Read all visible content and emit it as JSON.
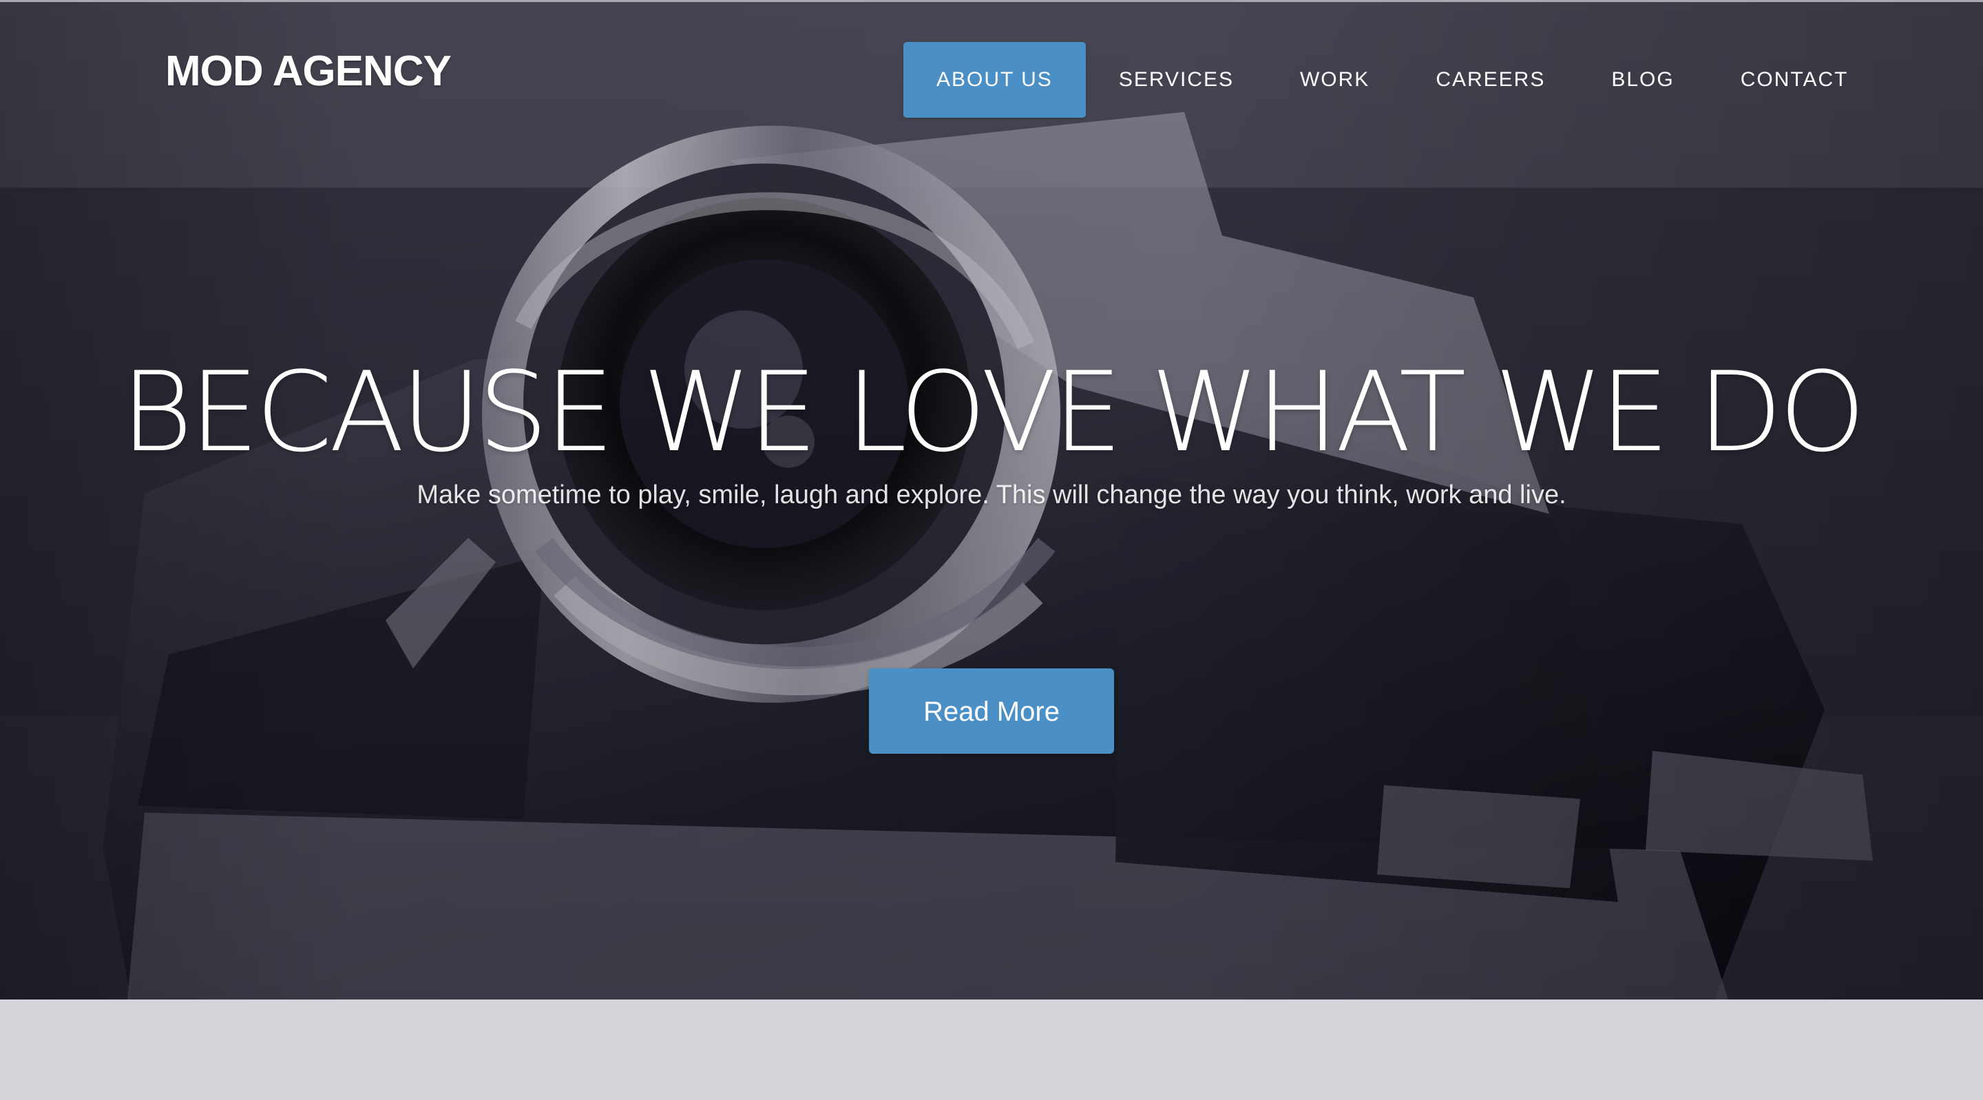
{
  "brand": {
    "name": "MOD AGENCY"
  },
  "navigation": {
    "items": [
      {
        "label": "ABOUT US",
        "active": true
      },
      {
        "label": "SERVICES",
        "active": false
      },
      {
        "label": "WORK",
        "active": false
      },
      {
        "label": "CAREERS",
        "active": false
      },
      {
        "label": "BLOG",
        "active": false
      },
      {
        "label": "CONTACT",
        "active": false
      }
    ]
  },
  "hero": {
    "title": "BECAUSE WE LOVE WHAT WE DO",
    "subtitle": "Make sometime to play, smile, laugh and explore. This will change the way you think, work and live.",
    "button_label": "Read More"
  },
  "colors": {
    "accent": "#4a8fc6",
    "hero_overlay": "#252533",
    "lower_band": "#d4d4db",
    "text": "#ffffff"
  },
  "image": {
    "subject_icon": "camera-icon"
  }
}
